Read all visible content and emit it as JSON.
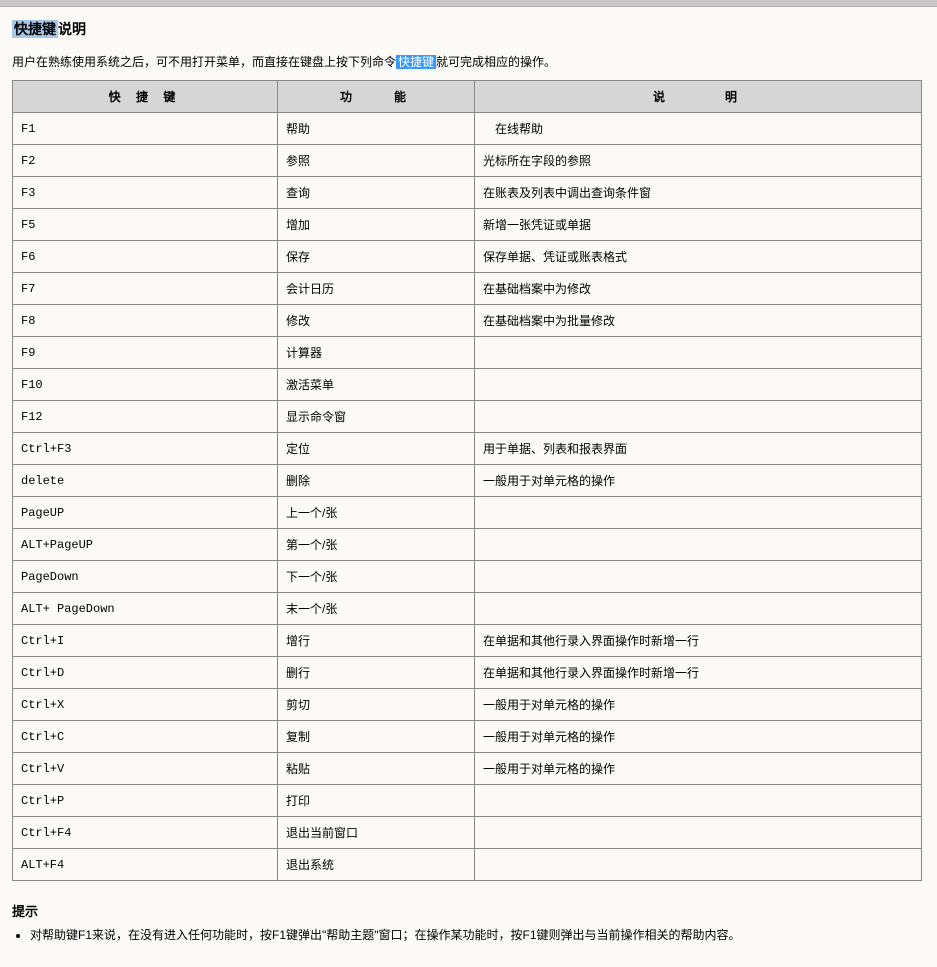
{
  "heading": {
    "highlight": "快捷键",
    "rest": "说明"
  },
  "intro": {
    "before": "用户在熟练使用系统之后，可不用打开菜单，而直接在键盘上按下列命令",
    "highlight": "快捷键",
    "after": "就可完成相应的操作。"
  },
  "table": {
    "headers": {
      "key": "快 捷 键",
      "func": "功　　能",
      "desc": "说　　　明"
    },
    "rows": [
      {
        "key": "F1",
        "func": "帮助",
        "desc": "在线帮助",
        "indent": true
      },
      {
        "key": "F2",
        "func": "参照",
        "desc": "光标所在字段的参照"
      },
      {
        "key": "F3",
        "func": "查询",
        "desc": "在账表及列表中调出查询条件窗"
      },
      {
        "key": "F5",
        "func": "增加",
        "desc": "新增一张凭证或单据"
      },
      {
        "key": "F6",
        "func": "保存",
        "desc": "保存单据、凭证或账表格式"
      },
      {
        "key": "F7",
        "func": "会计日历",
        "desc": "在基础档案中为修改"
      },
      {
        "key": "F8",
        "func": "修改",
        "desc": "在基础档案中为批量修改"
      },
      {
        "key": "F9",
        "func": "计算器",
        "desc": ""
      },
      {
        "key": "F10",
        "func": "激活菜单",
        "desc": ""
      },
      {
        "key": "F12",
        "func": "显示命令窗",
        "desc": ""
      },
      {
        "key": "Ctrl+F3",
        "func": "定位",
        "desc": "用于单据、列表和报表界面"
      },
      {
        "key": "delete",
        "func": "删除",
        "desc": "一般用于对单元格的操作"
      },
      {
        "key": "PageUP",
        "func": "上一个/张",
        "desc": ""
      },
      {
        "key": "ALT+PageUP",
        "func": "第一个/张",
        "desc": ""
      },
      {
        "key": "PageDown",
        "func": "下一个/张",
        "desc": ""
      },
      {
        "key": "ALT+ PageDown",
        "func": "末一个/张",
        "desc": ""
      },
      {
        "key": "Ctrl+I",
        "func": "增行",
        "desc": "在单据和其他行录入界面操作时新增一行"
      },
      {
        "key": "Ctrl+D",
        "func": "删行",
        "desc": "在单据和其他行录入界面操作时新增一行"
      },
      {
        "key": "Ctrl+X",
        "func": "剪切",
        "desc": "一般用于对单元格的操作"
      },
      {
        "key": "Ctrl+C",
        "func": "复制",
        "desc": "一般用于对单元格的操作"
      },
      {
        "key": "Ctrl+V",
        "func": "粘贴",
        "desc": "一般用于对单元格的操作"
      },
      {
        "key": "Ctrl+P",
        "func": "打印",
        "desc": ""
      },
      {
        "key": "Ctrl+F4",
        "func": "退出当前窗口",
        "desc": ""
      },
      {
        "key": "ALT+F4",
        "func": "退出系统",
        "desc": ""
      }
    ]
  },
  "tips": {
    "title": "提示",
    "items": [
      "对帮助键F1来说，在没有进入任何功能时，按F1键弹出\"帮助主题\"窗口；在操作某功能时，按F1键则弹出与当前操作相关的帮助内容。"
    ]
  }
}
